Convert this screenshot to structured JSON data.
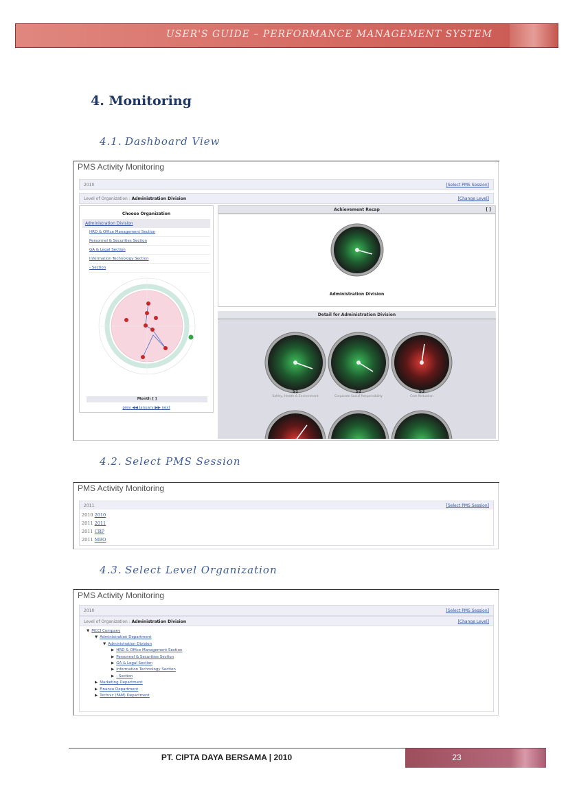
{
  "header": {
    "title": "USER'S GUIDE – PERFORMANCE MANAGEMENT SYSTEM"
  },
  "section": {
    "number": "4.",
    "title": "Monitoring"
  },
  "subsections": [
    {
      "number": "4.1.",
      "title": "Dashboard View"
    },
    {
      "number": "4.2.",
      "title": "Select PMS Session"
    },
    {
      "number": "4.3.",
      "title": "Select Level Organization"
    }
  ],
  "dashboard": {
    "panel_title": "PMS Activity Monitoring",
    "year": "2010",
    "select_session": "[Select PMS Session]",
    "level_label": "Level of Organization :",
    "level_value": "Administration Division",
    "change_level": "[Change Level]",
    "choose_org": "Choose Organization",
    "org_selected": "Administration Division",
    "org_items": [
      "HRD & Office Management Section",
      "Personnel & Securities Section",
      "GA & Legal Section",
      "Information Technology Section",
      "- Section"
    ],
    "month_label": "Month [ ]",
    "month_nav": {
      "prev": "prev",
      "month": "January",
      "next": "next"
    },
    "recap_title": "Achievement Recap",
    "recap_bracket": "[ ]",
    "recap_gauge_caption": "Administration Division",
    "detail_title": "Detail for Administration Division",
    "detail_gauges": [
      {
        "code": "S1",
        "desc": "Safety, Health & Environment",
        "status": "green"
      },
      {
        "code": "S2",
        "desc": "Corporate Social Responsibility",
        "status": "green"
      },
      {
        "code": "S3",
        "desc": "Cost Reduction",
        "status": "red"
      }
    ],
    "colors": {
      "green": "#2ea84e",
      "red": "#c0262b"
    }
  },
  "session_panel": {
    "panel_title": "PMS Activity Monitoring",
    "current": "2011",
    "select_session": "[Select PMS Session]",
    "rows": [
      {
        "year": "2010",
        "link": "2010"
      },
      {
        "year": "2011",
        "link": "2011"
      },
      {
        "year": "2011",
        "link": "CRP"
      },
      {
        "year": "2011",
        "link": "MBO"
      }
    ]
  },
  "level_panel": {
    "panel_title": "PMS Activity Monitoring",
    "year": "2010",
    "select_session": "[Select PMS Session]",
    "level_label": "Level of Organization :",
    "level_value": "Administration Division",
    "change_level": "[Change Level]",
    "tree": [
      {
        "label": "MCCI Company",
        "depth": 0,
        "open": true
      },
      {
        "label": "Administration Department",
        "depth": 1,
        "open": true
      },
      {
        "label": "Administration Division",
        "depth": 2,
        "open": true
      },
      {
        "label": "HRD & Office Management Section",
        "depth": 3,
        "open": false
      },
      {
        "label": "Personnel & Securities Section",
        "depth": 3,
        "open": false
      },
      {
        "label": "GA & Legal Section",
        "depth": 3,
        "open": false
      },
      {
        "label": "Information Technology Section",
        "depth": 3,
        "open": false
      },
      {
        "label": "- Section",
        "depth": 3,
        "open": false
      },
      {
        "label": "Marketing Department",
        "depth": 1,
        "open": false
      },
      {
        "label": "Finance Department",
        "depth": 1,
        "open": false
      },
      {
        "label": "Technic (FAM) Department",
        "depth": 1,
        "open": false
      }
    ]
  },
  "footer": {
    "company": "PT. CIPTA DAYA BERSAMA | 2010",
    "page": "23"
  }
}
